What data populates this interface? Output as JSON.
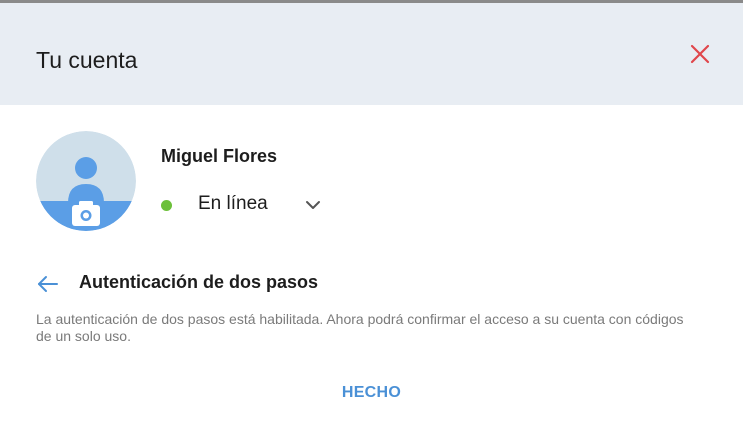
{
  "dialog": {
    "title": "Tu cuenta"
  },
  "profile": {
    "name": "Miguel Flores",
    "status": "En línea",
    "status_color": "#6cc03a"
  },
  "two_factor": {
    "title": "Autenticación de dos pasos",
    "description": "La autenticación de dos pasos está habilitada. Ahora podrá confirmar el acceso a su cuenta con códigos de un solo uso."
  },
  "actions": {
    "done_label": "HECHO"
  },
  "colors": {
    "header_bg": "#e8edf3",
    "accent": "#4a90d6",
    "close": "#e0474c",
    "avatar_bg": "#cfdfea"
  },
  "icons": {
    "close": "close-icon",
    "camera": "camera-icon",
    "chevron": "chevron-down-icon",
    "back": "arrow-left-icon"
  }
}
